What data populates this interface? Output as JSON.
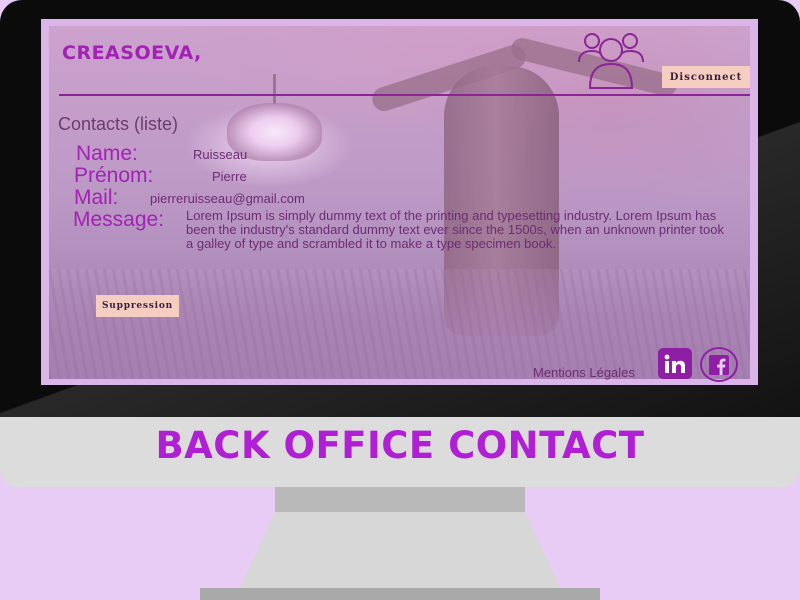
{
  "app": {
    "brand": "CREASOEVA,",
    "disconnect_label": "Disconnect"
  },
  "contact": {
    "section_title": "Contacts (liste)",
    "fields": [
      {
        "label": "Name:",
        "value": "Ruisseau"
      },
      {
        "label": "Prénom:",
        "value": "Pierre"
      },
      {
        "label": "Mail:",
        "value": "pierreruisseau@gmail.com"
      },
      {
        "label": "Message:",
        "value": "Lorem Ipsum is simply dummy text of the printing and typesetting industry. Lorem Ipsum has been the industry's standard dummy text ever since the 1500s, when an unknown printer took a galley of type and scrambled it to make a type specimen book."
      }
    ],
    "delete_label": "Suppression"
  },
  "footer": {
    "mentions_label": "Mentions Légales",
    "social": [
      "linkedin-icon",
      "facebook-icon"
    ]
  },
  "banner": {
    "title": "BACK OFFICE CONTACT"
  },
  "colors": {
    "brand": "#a322b5",
    "button": "#f6cdc1",
    "banner": "#b01ed6",
    "screen_background": "#e9ccf6"
  }
}
